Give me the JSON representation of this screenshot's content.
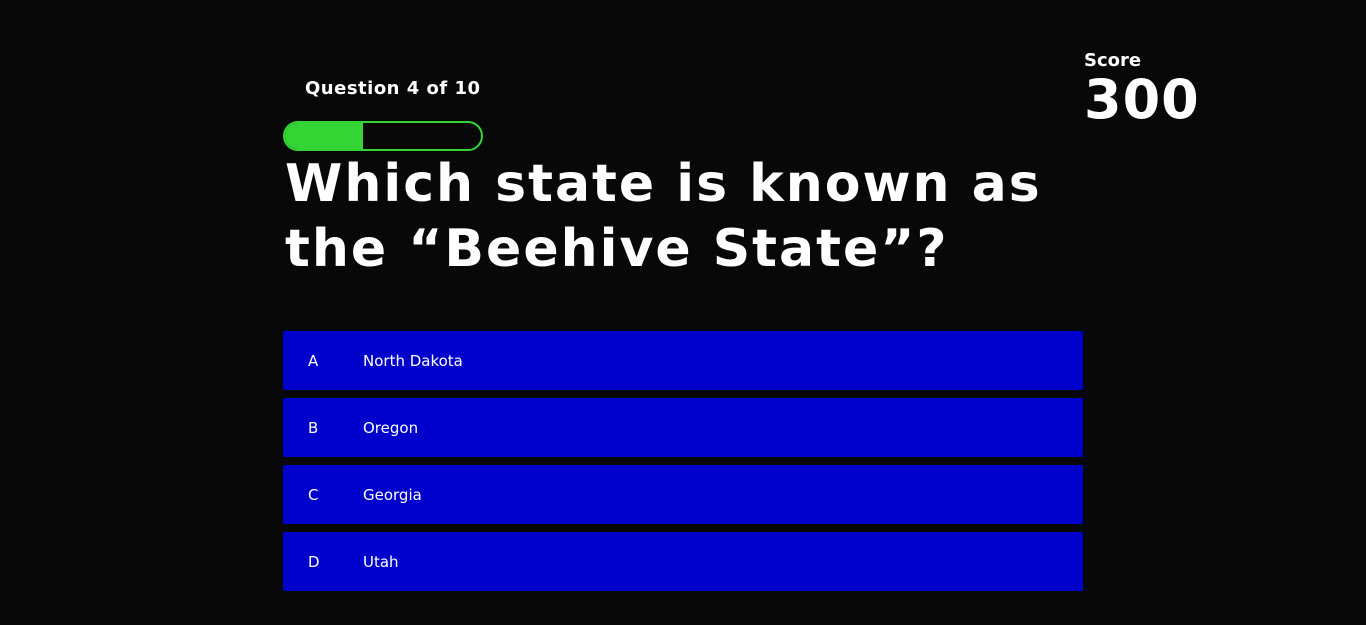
{
  "header": {
    "question_counter": "Question 4 of 10",
    "progress": 0.4,
    "progress_color": "#33d433",
    "score_label": "Score",
    "score_value": "300"
  },
  "question": {
    "text": "Which state is known as the “Beehive State”?"
  },
  "answers": [
    {
      "letter": "A",
      "text": "North Dakota"
    },
    {
      "letter": "B",
      "text": "Oregon"
    },
    {
      "letter": "C",
      "text": "Georgia"
    },
    {
      "letter": "D",
      "text": "Utah"
    }
  ],
  "colors": {
    "background": "#080808",
    "answer_background": "#0000cc",
    "text": "#ffffff"
  }
}
